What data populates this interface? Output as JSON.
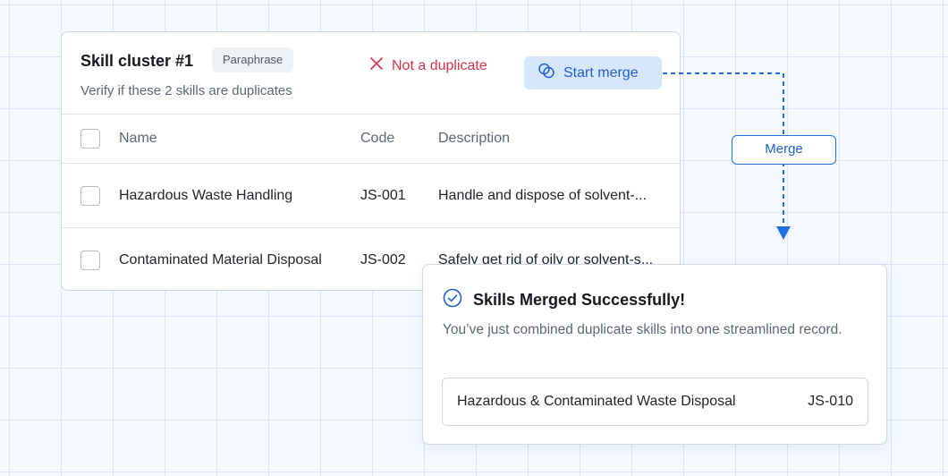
{
  "cluster": {
    "title": "Skill cluster #1",
    "badge": "Paraphrase",
    "subtitle": "Verify if these 2 skills are duplicates",
    "not_duplicate_label": "Not a duplicate",
    "start_merge_label": "Start merge",
    "columns": {
      "name": "Name",
      "code": "Code",
      "description": "Description"
    },
    "rows": [
      {
        "name": "Hazardous Waste Handling",
        "code": "JS-001",
        "description": "Handle and dispose of solvent-..."
      },
      {
        "name": "Contaminated Material Disposal",
        "code": "JS-002",
        "description": "Safely get rid of oily or solvent-s..."
      }
    ]
  },
  "connector": {
    "label": "Merge"
  },
  "result": {
    "title": "Skills Merged Successfully!",
    "message": "You’ve just combined duplicate skills into one streamlined record.",
    "merged_name": "Hazardous & Contaminated Waste Disposal",
    "merged_code": "JS-010"
  },
  "colors": {
    "accent": "#1e5fd0",
    "danger": "#d6334a",
    "merge_button_bg": "#d6e6fb",
    "grid_line": "#d6e5fb"
  }
}
